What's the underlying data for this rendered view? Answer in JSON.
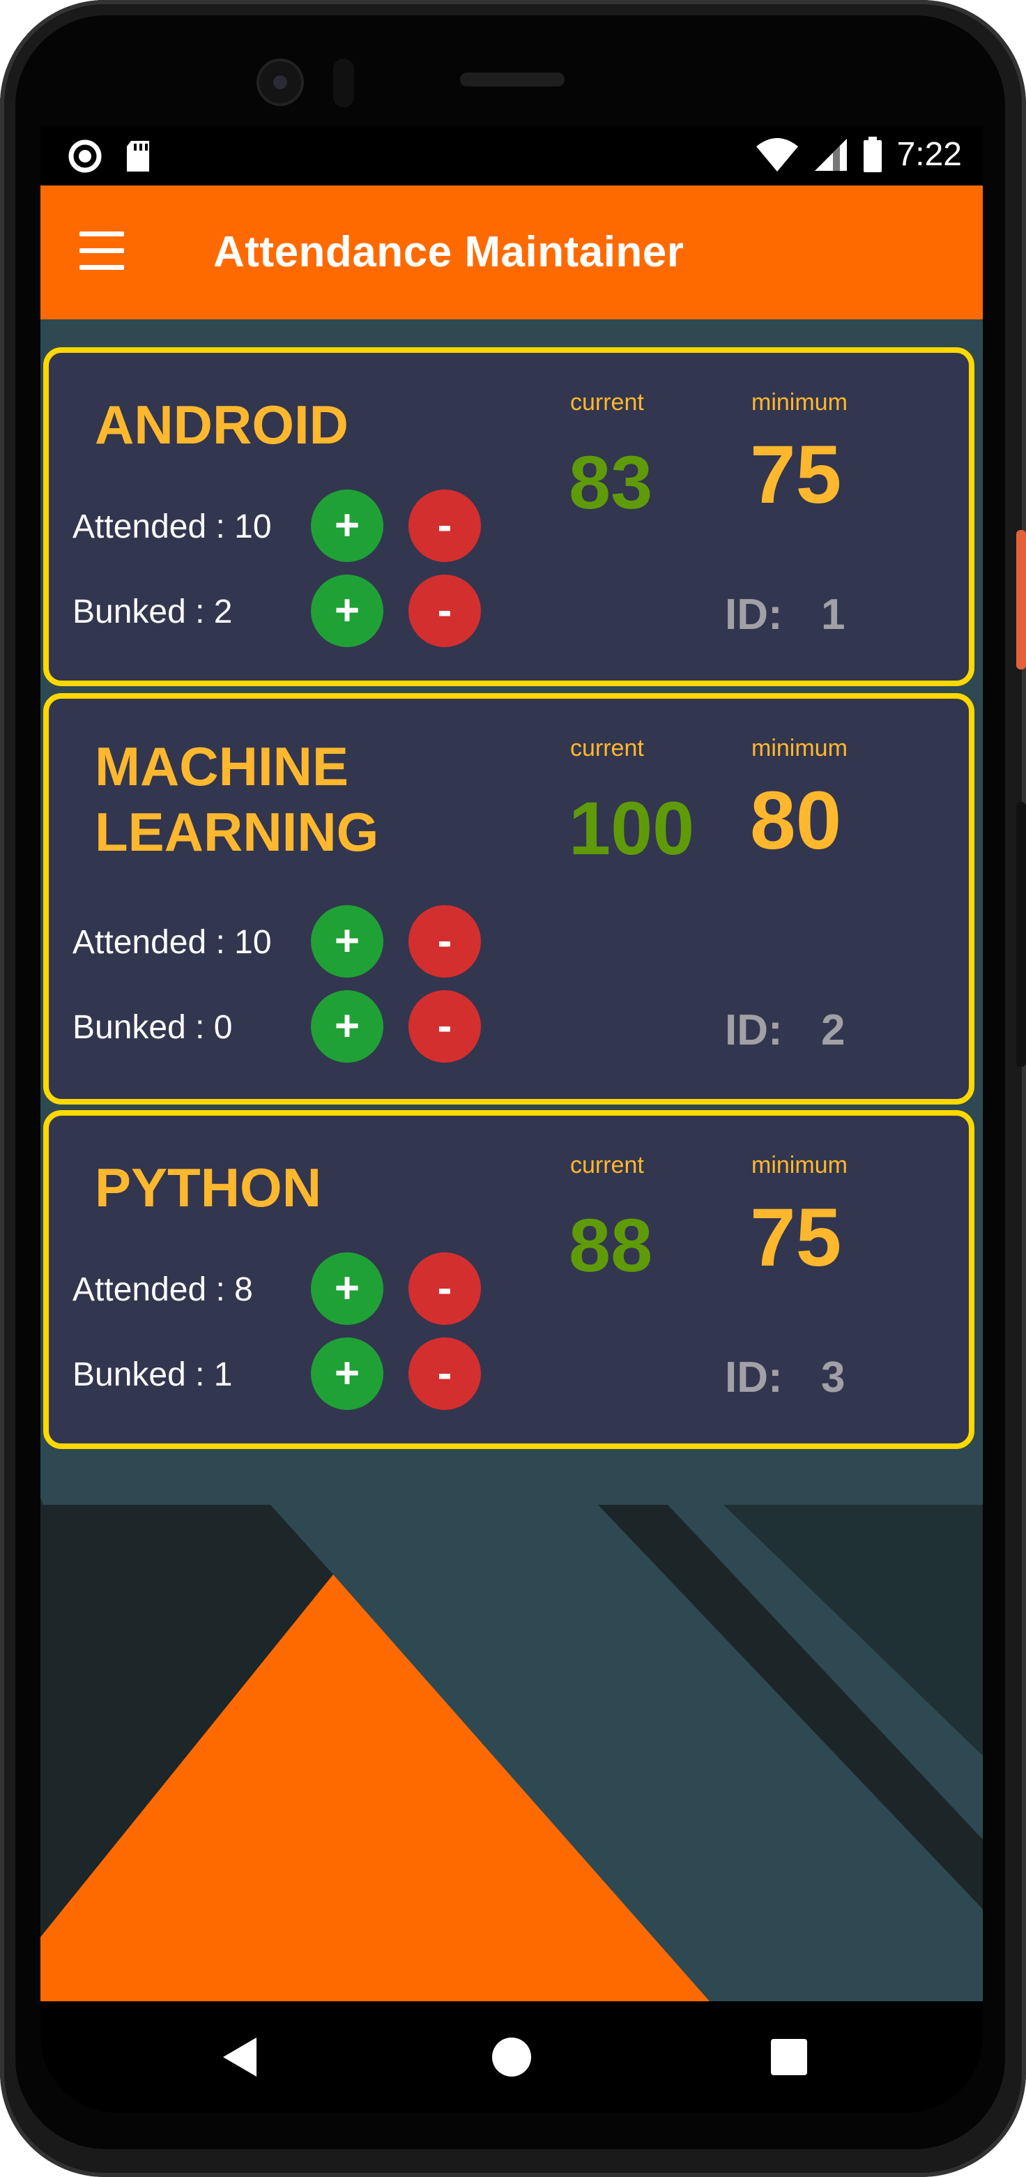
{
  "status_bar": {
    "time": "7:22",
    "left_icons": [
      "sync-circle-icon",
      "sd-card-icon"
    ],
    "right_icons": [
      "wifi-icon",
      "cell-signal-icon",
      "battery-icon"
    ]
  },
  "app_bar": {
    "title": "Attendance Maintainer",
    "menu_icon": "hamburger-menu-icon"
  },
  "labels": {
    "current": "current",
    "minimum": "minimum",
    "id": "ID:",
    "plus": "+",
    "minus": "-"
  },
  "subjects": [
    {
      "name": "ANDROID",
      "attended_text": "Attended : 10",
      "bunked_text": "Bunked : 2",
      "current": "83",
      "minimum": "75",
      "id": "1"
    },
    {
      "name_line1": "MACHINE",
      "name_line2": "LEARNING",
      "attended_text": "Attended : 10",
      "bunked_text": "Bunked : 0",
      "current": "100",
      "minimum": "80",
      "id": "2"
    },
    {
      "name": "PYTHON",
      "attended_text": "Attended : 8",
      "bunked_text": "Bunked : 1",
      "current": "88",
      "minimum": "75",
      "id": "3"
    }
  ],
  "colors": {
    "app_bar": "#ff6a00",
    "card_background": "#33364f",
    "card_border": "#ffd800",
    "subject_text": "#ffb82e",
    "current_value": "#5f9b08",
    "plus_button": "#1fa136",
    "minus_button": "#d32f2f"
  },
  "nav_bar": {
    "icons": [
      "back-triangle-icon",
      "home-circle-icon",
      "recents-square-icon"
    ]
  }
}
